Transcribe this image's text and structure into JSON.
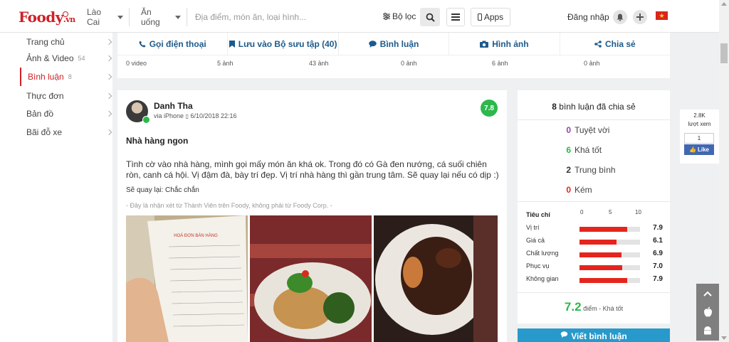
{
  "colors": {
    "brand": "#cf2127",
    "action_blue": "#1c5a8c",
    "good_green": "#2db84c",
    "bar_red": "#e5251d",
    "button_blue": "#2899cb",
    "facebook_blue": "#4267b2"
  },
  "header": {
    "logo": "Foody",
    "logo_suffix": ".vn",
    "city": "Lào Cai",
    "category": "Ăn uống",
    "search_placeholder": "Địa điểm, món ăn, loại hình...",
    "filter_label": "Bộ lọc",
    "apps_label": "Apps",
    "login_label": "Đăng nhập",
    "icons": [
      "search-icon",
      "menu-icon",
      "phone-icon",
      "bell-icon",
      "plus-icon",
      "vietnam-flag-icon"
    ]
  },
  "sidebar": {
    "items": [
      {
        "label": "Trang chủ",
        "count": "",
        "active": false
      },
      {
        "label": "Ảnh & Video",
        "count": "54",
        "active": false
      },
      {
        "label": "Bình luận",
        "count": "8",
        "active": true
      },
      {
        "label": "Thực đơn",
        "count": "",
        "active": false
      },
      {
        "label": "Bản đồ",
        "count": "",
        "active": false
      },
      {
        "label": "Bãi đỗ xe",
        "count": "",
        "active": false
      }
    ]
  },
  "actions": {
    "buttons": [
      {
        "label": "Gọi điện thoại",
        "icon": "phone-icon"
      },
      {
        "label": "Lưu vào Bộ sưu tập (40)",
        "icon": "bookmark-icon"
      },
      {
        "label": "Bình luận",
        "icon": "comment-icon"
      },
      {
        "label": "Hình ảnh",
        "icon": "camera-icon"
      },
      {
        "label": "Chia sẻ",
        "icon": "share-icon"
      }
    ],
    "counts": [
      "0 video",
      "5 ảnh",
      "43 ảnh",
      "0 ảnh",
      "6 ảnh",
      "0 ảnh"
    ]
  },
  "review": {
    "user": "Danh Tha",
    "via": "via iPhone",
    "date": "6/10/2018 22:16",
    "score": "7.8",
    "title": "Nhà hàng ngon",
    "body": "Tình cờ vào nhà hàng, mình gọi mấy món ăn khá ok. Trong đó có Gà đen nướng, cá suối chiên ròn, canh cá hội. Vị đậm đà, bày trí đẹp. Vị trí nhà hàng thì gần trung tâm. Sẽ quay lại nếu có dịp :)",
    "come_back": "Sẽ quay lại: Chắc chắn",
    "note": "- Đây là nhận xét từ Thành Viên trên Foody, không phải từ Foody Corp. -",
    "photos": [
      "receipt-photo",
      "fried-fish-photo",
      "grilled-chicken-photo"
    ]
  },
  "summary": {
    "shared_count": "8",
    "shared_label": "bình luận đã chia sẻ",
    "tallies": [
      {
        "count": "0",
        "label": "Tuyệt vời",
        "color": "#8e44ad"
      },
      {
        "count": "6",
        "label": "Khá tốt",
        "color": "#2db84c"
      },
      {
        "count": "2",
        "label": "Trung bình",
        "color": "#333333"
      },
      {
        "count": "0",
        "label": "Kém",
        "color": "#e5251d"
      }
    ],
    "criteria_header": "Tiêu chí",
    "scale": [
      "0",
      "5",
      "10"
    ],
    "criteria": [
      {
        "label": "Vị trí",
        "value": "7.9",
        "score": 7.9
      },
      {
        "label": "Giá cả",
        "value": "6.1",
        "score": 6.1
      },
      {
        "label": "Chất lượng",
        "value": "6.9",
        "score": 6.9
      },
      {
        "label": "Phục vụ",
        "value": "7.0",
        "score": 7.0
      },
      {
        "label": "Không gian",
        "value": "7.9",
        "score": 7.9
      }
    ],
    "average": "7.2",
    "average_label": "điểm - Khá tốt",
    "write_button": "Viết bình luận"
  },
  "views": {
    "count": "2.8K",
    "label": "lượt xem",
    "like_count": "1",
    "like_label": "Like"
  }
}
